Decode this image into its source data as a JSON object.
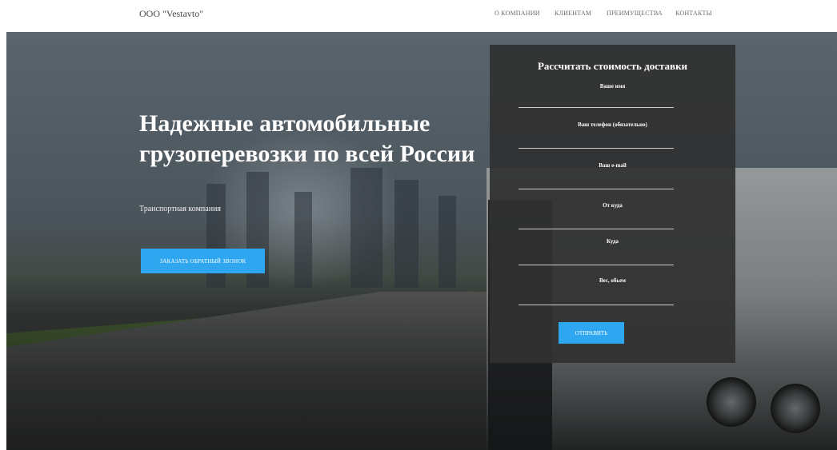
{
  "header": {
    "brand": "ООО \"Vestavto\"",
    "nav": [
      {
        "label": "О КОМПАНИИ"
      },
      {
        "label": "КЛИЕНТАМ"
      },
      {
        "label": "ПРЕИМУЩЕСТВА"
      },
      {
        "label": "КОНТАКТЫ"
      }
    ]
  },
  "hero": {
    "title": "Надежные автомобильные грузоперевозки по всей России",
    "subtitle": "Транспортная компания",
    "cta_label": "ЗАКАЗАТЬ ОБРАТНЫЙ ЗВОНОК"
  },
  "form": {
    "title": "Рассчитать стоимость доставки",
    "fields": [
      {
        "label": "Ваше имя",
        "value": ""
      },
      {
        "label": "Ваш телефон (обязательно)",
        "value": ""
      },
      {
        "label": "Ваш e-mail",
        "value": ""
      },
      {
        "label": "От куда",
        "value": ""
      },
      {
        "label": "Куда",
        "value": ""
      },
      {
        "label": "Вес, обьем",
        "value": ""
      }
    ],
    "submit_label": "ОТПРАВИТЬ"
  },
  "colors": {
    "accent": "#2fa7f0",
    "panel": "#303030"
  }
}
